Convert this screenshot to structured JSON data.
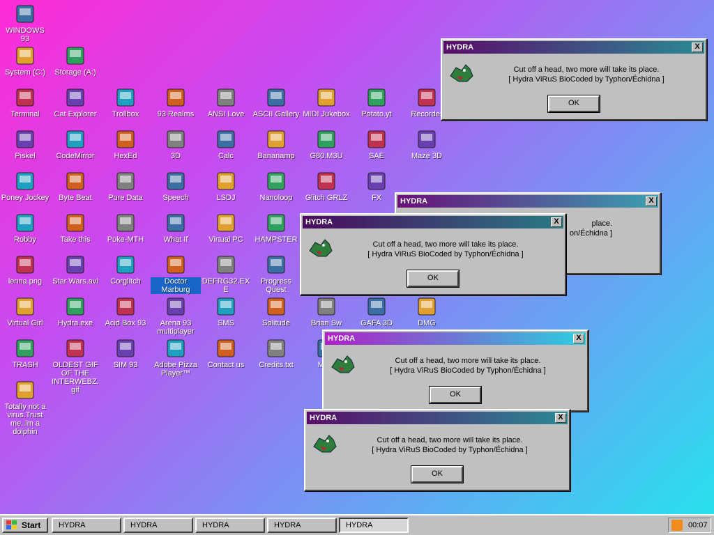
{
  "desktop": {
    "icons": [
      {
        "label": "WINDOWS 93",
        "icon": "computer-icon"
      },
      {
        "label": "System (C:)",
        "icon": "drive-icon"
      },
      {
        "label": "Storage (A:)",
        "icon": "floppy-icon"
      },
      {
        "label": "Terminal",
        "icon": "terminal-icon"
      },
      {
        "label": "Cat Explorer",
        "icon": "cat-explorer-icon"
      },
      {
        "label": "Trollbox",
        "icon": "chat-icon"
      },
      {
        "label": "93 Realms",
        "icon": "realms-icon"
      },
      {
        "label": "ANSI Love",
        "icon": "ansi-icon"
      },
      {
        "label": "ASCII Gallery",
        "icon": "ascii-icon"
      },
      {
        "label": "MIDI Jukebox",
        "icon": "piano-icon"
      },
      {
        "label": "Potato.yt",
        "icon": "potato-icon"
      },
      {
        "label": "Recorder",
        "icon": "microphone-icon"
      },
      {
        "label": "Piskel",
        "icon": "palette-icon"
      },
      {
        "label": "CodeMirror",
        "icon": "codemirror-icon"
      },
      {
        "label": "HexEd",
        "icon": "cube-icon"
      },
      {
        "label": "3D",
        "icon": "teapot-icon"
      },
      {
        "label": "Calc",
        "icon": "calculator-icon"
      },
      {
        "label": "Bananamp",
        "icon": "banana-icon"
      },
      {
        "label": "G80.M3U",
        "icon": "audio-file-icon"
      },
      {
        "label": "SAE",
        "icon": "ball-icon"
      },
      {
        "label": "Maze 3D",
        "icon": "maze-icon"
      },
      {
        "label": "Poney Jockey",
        "icon": "pony-icon"
      },
      {
        "label": "Byte Beat",
        "icon": "bytebeat-icon"
      },
      {
        "label": "Pure Data",
        "icon": "puredata-icon"
      },
      {
        "label": "Speech",
        "icon": "speech-icon"
      },
      {
        "label": "LSDJ",
        "icon": "lsdj-icon"
      },
      {
        "label": "Nanoloop",
        "icon": "nanoloop-icon"
      },
      {
        "label": "Glitch GRLZ",
        "icon": "lips-icon"
      },
      {
        "label": "FX",
        "icon": "atom-icon"
      },
      {
        "label": "Robby",
        "icon": "stick-figure-icon"
      },
      {
        "label": "Take this",
        "icon": "character-icon"
      },
      {
        "label": "Poke-MTH",
        "icon": "poke-icon"
      },
      {
        "label": "What If",
        "icon": "whatif-icon"
      },
      {
        "label": "Virtual PC",
        "icon": "virtual-pc-icon"
      },
      {
        "label": "HAMPSTER",
        "icon": "hamster-icon"
      },
      {
        "label": "lenna.png",
        "icon": "image-file-icon"
      },
      {
        "label": "Star Wars.avi",
        "icon": "yoda-icon"
      },
      {
        "label": "Corglitch",
        "icon": "corgi-icon"
      },
      {
        "label": "Doctor Marburg",
        "icon": "doctor-icon"
      },
      {
        "label": "DEFRG32.EXE",
        "icon": "defrag-icon"
      },
      {
        "label": "Progress Quest",
        "icon": "progress-quest-icon"
      },
      {
        "label": "Virtual Girl",
        "icon": "virtual-girl-icon"
      },
      {
        "label": "Hydra.exe",
        "icon": "hydra-icon"
      },
      {
        "label": "Acid Box 93",
        "icon": "smiley-icon"
      },
      {
        "label": "Arena 93 multiplayer",
        "icon": "arena-icon"
      },
      {
        "label": "SMS",
        "icon": "sms-icon"
      },
      {
        "label": "Solitude",
        "icon": "solitude-icon"
      },
      {
        "label": "Brian Sw",
        "icon": "virus-icon"
      },
      {
        "label": "GAFA 3D",
        "icon": "gafa-icon"
      },
      {
        "label": "DMG",
        "icon": "dmg-icon"
      },
      {
        "label": "TRASH",
        "icon": "trash-icon"
      },
      {
        "label": "OLDEST GIF OF THE INTERWEBZ.gif",
        "icon": "gif-file-icon"
      },
      {
        "label": "SIM 93",
        "icon": "sim-icon"
      },
      {
        "label": "Adobe Pizza Player™",
        "icon": "pizza-icon"
      },
      {
        "label": "Contact us",
        "icon": "contact-icon"
      },
      {
        "label": "Credits.txt",
        "icon": "text-file-icon"
      },
      {
        "label": "MAN",
        "icon": "man-icon"
      },
      {
        "label": "Totally not a virus.Trust me..im a dolphin",
        "icon": "dolphin-icon"
      }
    ]
  },
  "dialogs": [
    {
      "title": "HYDRA",
      "line1": "Cut off a head, two more will take its place.",
      "line2": "[ Hydra ViRuS BioCoded by Typhon/Échidna ]",
      "ok": "OK",
      "close": "X"
    },
    {
      "title": "HYDRA",
      "line1": "",
      "line2": "",
      "ok": "",
      "close": "X"
    },
    {
      "title": "HYDRA",
      "line1": "Cut off a head, two more will take its place.",
      "line2": "[ Hydra ViRuS BioCoded by Typhon/Échidna ]",
      "ok": "OK",
      "close": "X"
    },
    {
      "title": "HYDRA",
      "line1": "Cut off a head, two more will take its place.",
      "line2": "[ Hydra ViRuS BioCoded by Typhon/Échidna ]",
      "ok": "OK",
      "close": "X"
    },
    {
      "title": "HYDRA",
      "line1": "Cut off a head, two more will take its place.",
      "line2": "[ Hydra ViRuS BioCoded by Typhon/Échidna ]",
      "ok": "OK",
      "close": "X"
    }
  ],
  "partial_dialog_text": {
    "line1_tail": "place.",
    "line2_tail": "on/Échidna ]"
  },
  "taskbar": {
    "start_label": "Start",
    "tasks": [
      {
        "label": "HYDRA"
      },
      {
        "label": "HYDRA"
      },
      {
        "label": "HYDRA"
      },
      {
        "label": "HYDRA"
      },
      {
        "label": "HYDRA"
      }
    ],
    "clock": "00:07"
  },
  "colors": {
    "title_gradient_start": "#5a0d6b",
    "title_gradient_end": "#2aa0a0",
    "selection": "#1a66c8"
  }
}
